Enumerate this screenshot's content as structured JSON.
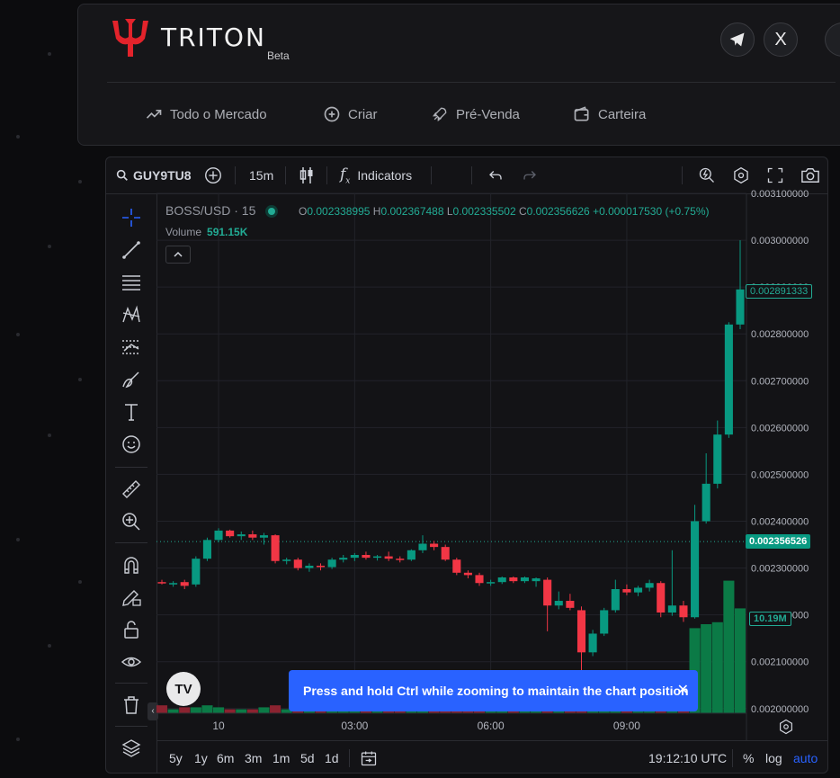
{
  "header": {
    "brand": "TRITON",
    "badge": "Beta",
    "social": [
      {
        "icon": "telegram-icon"
      },
      {
        "icon": "x-icon",
        "glyph": "X"
      }
    ],
    "nav": [
      {
        "label": "Todo o Mercado",
        "icon": "trending-icon"
      },
      {
        "label": "Criar",
        "icon": "plus-circle-icon"
      },
      {
        "label": "Pré-Venda",
        "icon": "rocket-icon"
      },
      {
        "label": "Carteira",
        "icon": "wallet-icon"
      }
    ]
  },
  "toolbar": {
    "symbol": "GUY9TU8",
    "interval": "15m",
    "indicators": "Indicators"
  },
  "legend": {
    "symbol": "BOSS/USD · 15",
    "open_label": "O",
    "open": "0.002338995",
    "high_label": "H",
    "high": "0.002367488",
    "low_label": "L",
    "low": "0.002335502",
    "close_label": "C",
    "close": "0.002356626",
    "change": "+0.000017530 (+0.75%)",
    "volume_label": "Volume",
    "volume": "591.15K"
  },
  "toast": {
    "text": "Press and hold Ctrl while zooming to maintain the chart position"
  },
  "bottom": {
    "ranges": [
      "5y",
      "1y",
      "6m",
      "3m",
      "1m",
      "5d",
      "1d"
    ],
    "time": "19:12:10 UTC",
    "percent": "%",
    "log": "log",
    "auto": "auto"
  },
  "colors": {
    "up": "#089981",
    "down": "#f23645",
    "accent": "#2962ff",
    "volume_up": "#0b7a46",
    "volume_down": "#8b2330"
  },
  "chart_data": {
    "type": "candlestick",
    "y_ticks": [
      "0.003100000",
      "0.003000000",
      "0.002900000",
      "0.002800000",
      "0.002700000",
      "0.002600000",
      "0.002500000",
      "0.002400000",
      "0.002300000",
      "0.002200000",
      "0.002100000",
      "0.002000000"
    ],
    "x_ticks": [
      "10",
      "03:00",
      "06:00",
      "09:00"
    ],
    "last_price": "0.002891333",
    "crosshair_price": "0.002356526",
    "volume_last": "10.19M",
    "ylim": [
      0.00199,
      0.0031
    ],
    "candles": [
      [
        0.00227,
        0.002275,
        0.002265,
        0.002268
      ],
      [
        0.002265,
        0.002272,
        0.00226,
        0.002268
      ],
      [
        0.00227,
        0.002275,
        0.002255,
        0.002262
      ],
      [
        0.002265,
        0.002325,
        0.00226,
        0.00232
      ],
      [
        0.00232,
        0.002365,
        0.002315,
        0.00236
      ],
      [
        0.00236,
        0.002385,
        0.002355,
        0.00238
      ],
      [
        0.00238,
        0.002382,
        0.002365,
        0.002368
      ],
      [
        0.002368,
        0.002378,
        0.00236,
        0.002372
      ],
      [
        0.002372,
        0.00238,
        0.00236,
        0.002365
      ],
      [
        0.002365,
        0.002375,
        0.00235,
        0.00237
      ],
      [
        0.00237,
        0.002372,
        0.00231,
        0.002315
      ],
      [
        0.002315,
        0.002322,
        0.002308,
        0.002318
      ],
      [
        0.002318,
        0.002322,
        0.002295,
        0.0023
      ],
      [
        0.0023,
        0.00231,
        0.002292,
        0.002305
      ],
      [
        0.002305,
        0.00231,
        0.002295,
        0.002302
      ],
      [
        0.002302,
        0.002322,
        0.002298,
        0.002318
      ],
      [
        0.002318,
        0.002328,
        0.002312,
        0.002322
      ],
      [
        0.002322,
        0.002332,
        0.002315,
        0.002328
      ],
      [
        0.002328,
        0.002335,
        0.002318,
        0.002322
      ],
      [
        0.002322,
        0.002328,
        0.002316,
        0.002325
      ],
      [
        0.002325,
        0.002335,
        0.002315,
        0.00232
      ],
      [
        0.00232,
        0.002325,
        0.002312,
        0.002318
      ],
      [
        0.002318,
        0.00234,
        0.002315,
        0.002338
      ],
      [
        0.002338,
        0.00237,
        0.002332,
        0.002352
      ],
      [
        0.002352,
        0.002358,
        0.002338,
        0.002345
      ],
      [
        0.002345,
        0.00235,
        0.002315,
        0.002318
      ],
      [
        0.002318,
        0.002322,
        0.002285,
        0.00229
      ],
      [
        0.00229,
        0.002295,
        0.002278,
        0.002285
      ],
      [
        0.002285,
        0.00229,
        0.002262,
        0.002268
      ],
      [
        0.002268,
        0.002275,
        0.002262,
        0.00227
      ],
      [
        0.00227,
        0.002282,
        0.002266,
        0.00228
      ],
      [
        0.00228,
        0.002282,
        0.002268,
        0.002272
      ],
      [
        0.002272,
        0.002282,
        0.002268,
        0.00228
      ],
      [
        0.002272,
        0.00228,
        0.00226,
        0.002278
      ],
      [
        0.002275,
        0.00228,
        0.002165,
        0.00222
      ],
      [
        0.00222,
        0.00225,
        0.002212,
        0.00223
      ],
      [
        0.00223,
        0.002245,
        0.00221,
        0.002215
      ],
      [
        0.00221,
        0.002218,
        0.00208,
        0.00212
      ],
      [
        0.00212,
        0.002168,
        0.002112,
        0.00216
      ],
      [
        0.00216,
        0.002215,
        0.002155,
        0.00221
      ],
      [
        0.00221,
        0.002275,
        0.002205,
        0.002255
      ],
      [
        0.002255,
        0.002265,
        0.002242,
        0.002248
      ],
      [
        0.002248,
        0.002262,
        0.00224,
        0.002258
      ],
      [
        0.002258,
        0.002275,
        0.00225,
        0.002268
      ],
      [
        0.002268,
        0.002272,
        0.002195,
        0.002205
      ],
      [
        0.002205,
        0.002338,
        0.002198,
        0.00222
      ],
      [
        0.00222,
        0.00223,
        0.002185,
        0.002195
      ],
      [
        0.002195,
        0.002435,
        0.002192,
        0.0024
      ],
      [
        0.0024,
        0.002545,
        0.002395,
        0.00248
      ],
      [
        0.00248,
        0.002615,
        0.00247,
        0.002585
      ],
      [
        0.002585,
        0.002825,
        0.002578,
        0.00282
      ],
      [
        0.00282,
        0.003,
        0.00281,
        0.002895
      ]
    ],
    "volumes": [
      0.04,
      0.02,
      0.03,
      0.03,
      0.04,
      0.03,
      0.02,
      0.02,
      0.02,
      0.03,
      0.04,
      0.02,
      0.03,
      0.02,
      0.02,
      0.03,
      0.02,
      0.02,
      0.02,
      0.02,
      0.02,
      0.02,
      0.02,
      0.03,
      0.02,
      0.03,
      0.02,
      0.02,
      0.02,
      0.02,
      0.02,
      0.02,
      0.02,
      0.03,
      0.1,
      0.03,
      0.02,
      0.15,
      0.03,
      0.03,
      0.03,
      0.02,
      0.02,
      0.02,
      0.03,
      0.17,
      0.03,
      0.43,
      0.45,
      0.46,
      0.67,
      0.53
    ]
  }
}
